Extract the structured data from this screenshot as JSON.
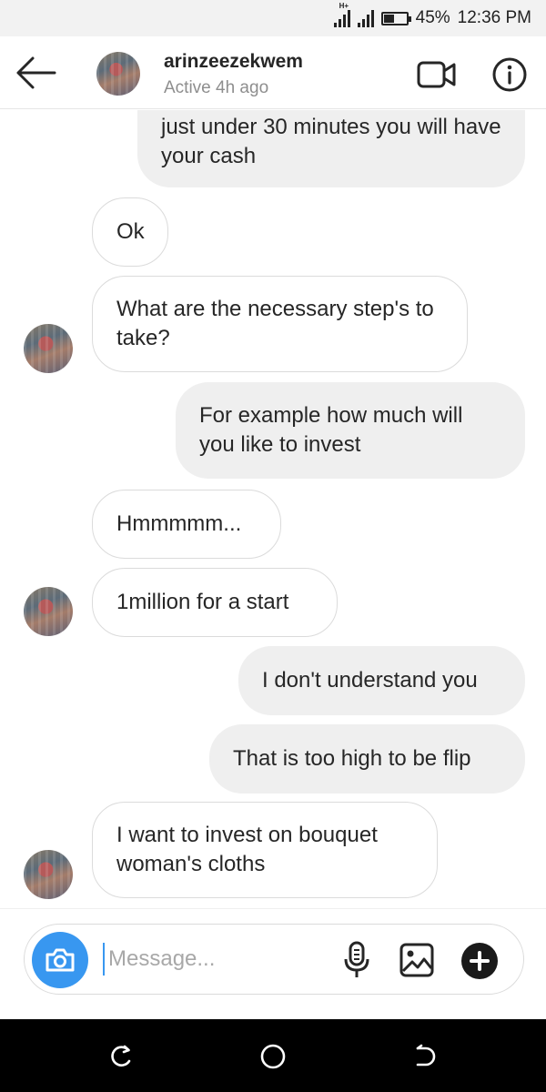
{
  "status_bar": {
    "network_badge": "H+",
    "battery_percent": "45%",
    "battery_level": 0.45,
    "time": "12:36 PM"
  },
  "header": {
    "username": "arinzeezekwem",
    "active_status": "Active 4h ago"
  },
  "messages": [
    {
      "side": "out",
      "text": "just under 30 minutes you will have your cash"
    },
    {
      "side": "in",
      "text": "Ok"
    },
    {
      "side": "in",
      "text": "What are the necessary step's to take?"
    },
    {
      "side": "out",
      "text": "For example how much will you like to invest"
    },
    {
      "side": "in",
      "text": "Hmmmmm..."
    },
    {
      "side": "in",
      "text": "1million for a start"
    },
    {
      "side": "out",
      "text": "I don't understand you"
    },
    {
      "side": "out",
      "text": "That is too high to be flip"
    },
    {
      "side": "in",
      "text": "I want to invest on bouquet woman's cloths"
    }
  ],
  "composer": {
    "placeholder": "Message..."
  },
  "colors": {
    "accent": "#3897f0",
    "incoming_border": "#dbdbdb",
    "outgoing_bg": "#efefef"
  }
}
